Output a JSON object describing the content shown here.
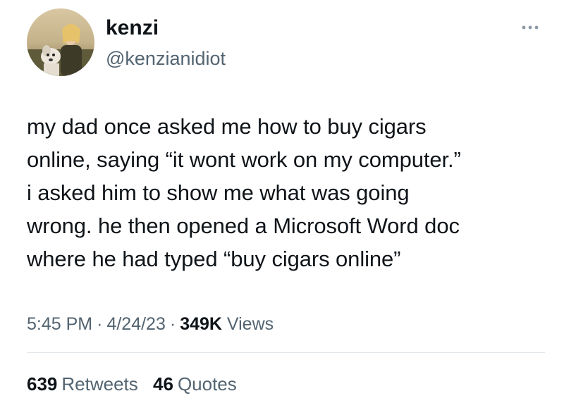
{
  "author": {
    "display_name": "kenzi",
    "handle": "@kenzianidiot",
    "avatar_icon": "avatar-photo"
  },
  "menu_icon": "more-horizontal-icon",
  "tweet": {
    "text": "my dad once asked me how to buy cigars\nonline, saying “it wont work on my computer.”\ni asked him to show me what was going\nwrong. he then opened a Microsoft Word doc\nwhere he had typed “buy cigars online”"
  },
  "meta": {
    "time": "5:45 PM",
    "separator": "·",
    "date": "4/24/23",
    "views_count": "349K",
    "views_label": "Views"
  },
  "stats": {
    "retweets_count": "639",
    "retweets_label": "Retweets",
    "quotes_count": "46",
    "quotes_label": "Quotes"
  },
  "colors": {
    "text": "#0f1419",
    "secondary": "#536471",
    "divider": "#e1e6ea"
  }
}
